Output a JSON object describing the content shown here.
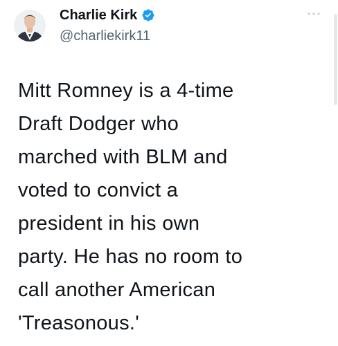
{
  "tweet": {
    "author": {
      "display_name": "Charlie Kirk",
      "handle": "@charliekirk11",
      "verified": true,
      "avatar_icon": "profile-photo",
      "verified_icon": "verified-badge-icon"
    },
    "more_icon": "more-options-icon",
    "text_lines": [
      "Mitt Romney is a 4-time",
      "Draft Dodger who",
      "marched with BLM and",
      "voted to convict a",
      "president in his own",
      "party. He has no room to",
      "call another American",
      "'Treasonous.'"
    ]
  },
  "colors": {
    "background": "#ffffff",
    "text_primary": "#0f1419",
    "text_secondary": "#536471",
    "verified_blue": "#1d9bf0",
    "more_icon": "#c8ced4"
  }
}
